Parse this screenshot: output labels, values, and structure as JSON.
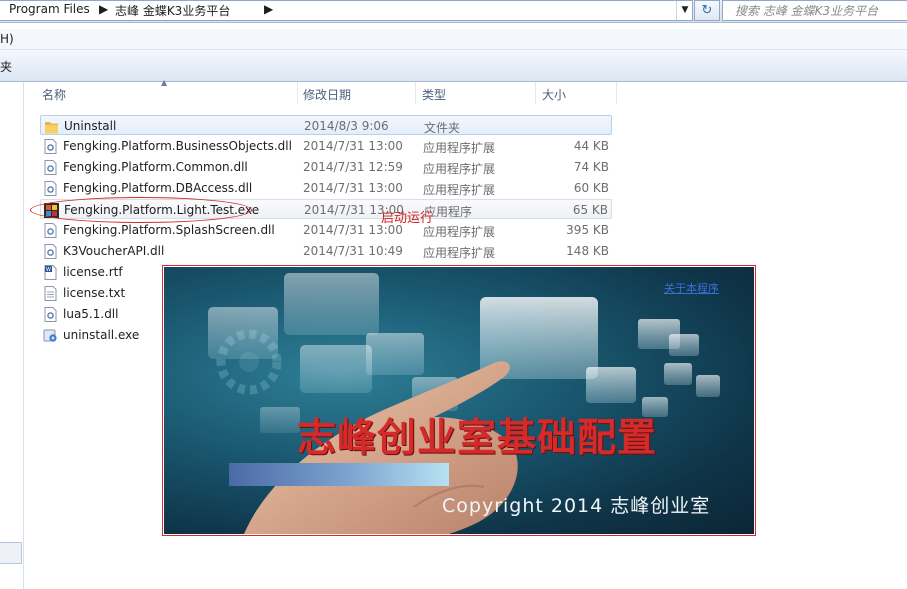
{
  "address": {
    "crumbs": [
      "Program Files",
      "志峰 金蝶K3业务平台"
    ],
    "search_placeholder": "搜索 志峰 金蝶K3业务平台"
  },
  "menubar": {
    "fragment": "H)"
  },
  "toolbar": {
    "fragment": "夹"
  },
  "columns": {
    "name": "名称",
    "date": "修改日期",
    "type": "类型",
    "size": "大小"
  },
  "files": [
    {
      "name": "Uninstall",
      "date": "2014/8/3 9:06",
      "type": "文件夹",
      "size": "",
      "icon": "folder-icon"
    },
    {
      "name": "Fengking.Platform.BusinessObjects.dll",
      "date": "2014/7/31 13:00",
      "type": "应用程序扩展",
      "size": "44 KB",
      "icon": "dll-icon"
    },
    {
      "name": "Fengking.Platform.Common.dll",
      "date": "2014/7/31 12:59",
      "type": "应用程序扩展",
      "size": "74 KB",
      "icon": "dll-icon"
    },
    {
      "name": "Fengking.Platform.DBAccess.dll",
      "date": "2014/7/31 13:00",
      "type": "应用程序扩展",
      "size": "60 KB",
      "icon": "dll-icon"
    },
    {
      "name": "Fengking.Platform.Light.Test.exe",
      "date": "2014/7/31 13:00",
      "type": "应用程序",
      "size": "65 KB",
      "icon": "exe-app-icon"
    },
    {
      "name": "Fengking.Platform.SplashScreen.dll",
      "date": "2014/7/31 13:00",
      "type": "应用程序扩展",
      "size": "395 KB",
      "icon": "dll-icon"
    },
    {
      "name": "K3VoucherAPI.dll",
      "date": "2014/7/31 10:49",
      "type": "应用程序扩展",
      "size": "148 KB",
      "icon": "dll-icon"
    },
    {
      "name": "license.rtf",
      "date": "",
      "type": "",
      "size": "",
      "icon": "rtf-icon"
    },
    {
      "name": "license.txt",
      "date": "",
      "type": "",
      "size": "",
      "icon": "txt-icon"
    },
    {
      "name": "lua5.1.dll",
      "date": "",
      "type": "",
      "size": "",
      "icon": "dll-icon"
    },
    {
      "name": "uninstall.exe",
      "date": "",
      "type": "",
      "size": "",
      "icon": "installer-icon"
    }
  ],
  "annotation": {
    "text": "启动运行",
    "color": "#d42020"
  },
  "splash": {
    "link": "关于本程序",
    "title": "志峰创业室基础配置",
    "copyright": "Copyright  2014 志峰创业室",
    "progress": 1.0,
    "title_color": "#d42a2a"
  }
}
